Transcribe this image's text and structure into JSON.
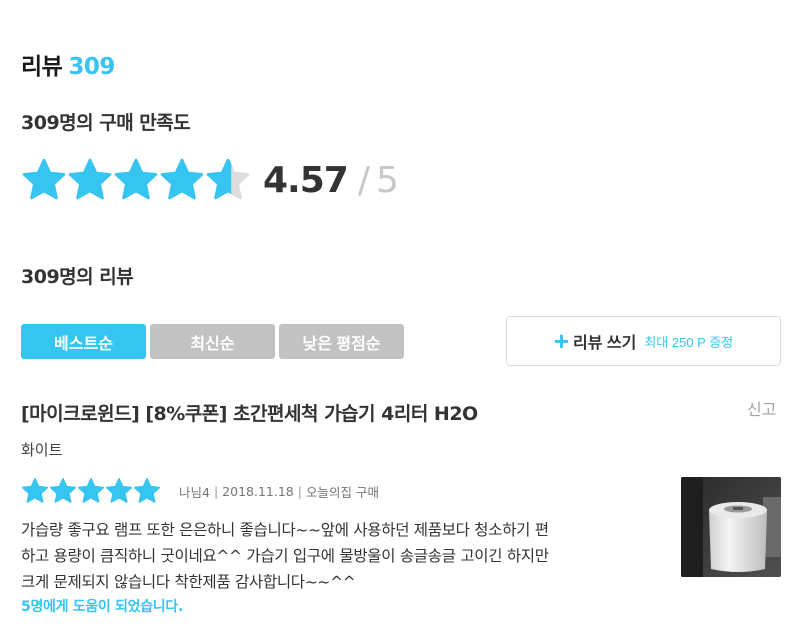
{
  "header": {
    "title": "리뷰",
    "count": "309"
  },
  "summary": {
    "satisfaction_label": "309명의 구매 만족도",
    "rating": "4.57",
    "rating_fraction": 0.914,
    "separator": "/",
    "max": "5",
    "star_color": "#35c5f0",
    "star_empty_color": "#dcdcdc"
  },
  "reviews": {
    "label": "309명의 리뷰",
    "sort_tabs": [
      {
        "label": "베스트순",
        "active": true
      },
      {
        "label": "최신순",
        "active": false
      },
      {
        "label": "낮은 평점순",
        "active": false
      }
    ],
    "write_button": {
      "label": "리뷰 쓰기",
      "sub": "최대 250 P 증정"
    }
  },
  "review_item": {
    "product": "[마이크로윈드] [8%쿠폰] 초간편세척 가습기 4리터 H2O",
    "report": "신고",
    "option": "화이트",
    "stars": 5,
    "author": "나님4",
    "date": "2018.11.18",
    "source": "오늘의집 구매",
    "body_lines": [
      "가습량 좋구요 램프 또한 은은하니 좋습니다~~앞에 사용하던 제품보다 청소하기 편",
      "하고 용량이 큼직하니 굿이네요^^ 가습기 입구에 물방울이 송글송글 고이긴 하지만",
      "크게 문제되지 않습니다 착한제품 감사합니다~~^^"
    ],
    "helpful": "5명에게 도움이 되었습니다."
  },
  "colors": {
    "accent": "#35c5f0",
    "tab_inactive": "#c2c2c2"
  }
}
